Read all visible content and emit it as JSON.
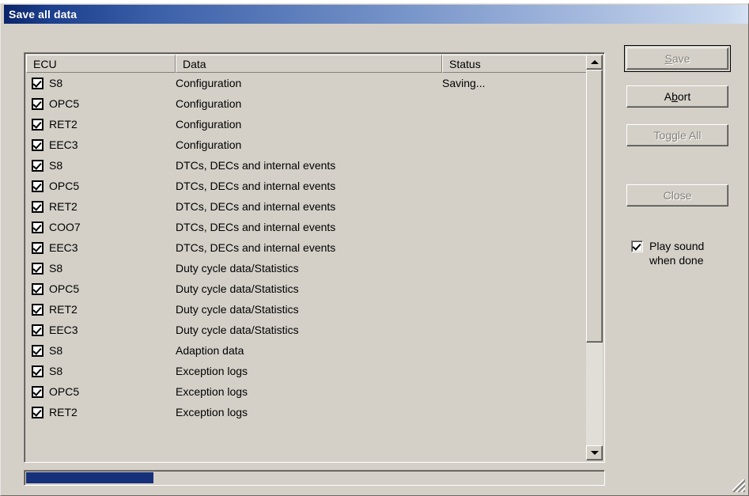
{
  "window": {
    "title": "Save all data"
  },
  "list": {
    "columns": [
      {
        "key": "ecu",
        "label": "ECU"
      },
      {
        "key": "data",
        "label": "Data"
      },
      {
        "key": "status",
        "label": "Status"
      }
    ],
    "rows": [
      {
        "checked": true,
        "ecu": "S8",
        "data": "Configuration",
        "status": "Saving..."
      },
      {
        "checked": true,
        "ecu": "OPC5",
        "data": "Configuration",
        "status": ""
      },
      {
        "checked": true,
        "ecu": "RET2",
        "data": "Configuration",
        "status": ""
      },
      {
        "checked": true,
        "ecu": "EEC3",
        "data": "Configuration",
        "status": ""
      },
      {
        "checked": true,
        "ecu": "S8",
        "data": "DTCs, DECs and internal events",
        "status": ""
      },
      {
        "checked": true,
        "ecu": "OPC5",
        "data": "DTCs, DECs and internal events",
        "status": ""
      },
      {
        "checked": true,
        "ecu": "RET2",
        "data": "DTCs, DECs and internal events",
        "status": ""
      },
      {
        "checked": true,
        "ecu": "COO7",
        "data": "DTCs, DECs and internal events",
        "status": ""
      },
      {
        "checked": true,
        "ecu": "EEC3",
        "data": "DTCs, DECs and internal events",
        "status": ""
      },
      {
        "checked": true,
        "ecu": "S8",
        "data": "Duty cycle data/Statistics",
        "status": ""
      },
      {
        "checked": true,
        "ecu": "OPC5",
        "data": "Duty cycle data/Statistics",
        "status": ""
      },
      {
        "checked": true,
        "ecu": "RET2",
        "data": "Duty cycle data/Statistics",
        "status": ""
      },
      {
        "checked": true,
        "ecu": "EEC3",
        "data": "Duty cycle data/Statistics",
        "status": ""
      },
      {
        "checked": true,
        "ecu": "S8",
        "data": "Adaption data",
        "status": ""
      },
      {
        "checked": true,
        "ecu": "S8",
        "data": "Exception logs",
        "status": ""
      },
      {
        "checked": true,
        "ecu": "OPC5",
        "data": "Exception logs",
        "status": ""
      },
      {
        "checked": true,
        "ecu": "RET2",
        "data": "Exception logs",
        "status": ""
      }
    ]
  },
  "scrollbar": {
    "up_arrow": "scroll-up-arrow",
    "down_arrow": "scroll-down-arrow"
  },
  "buttons": {
    "save": {
      "label": "Save",
      "accel": "S",
      "enabled": false,
      "default": true
    },
    "abort": {
      "label": "Abort",
      "accel": "b",
      "enabled": true,
      "default": false
    },
    "toggle_all": {
      "label": "Toggle All",
      "accel": "",
      "enabled": false,
      "default": false
    },
    "close": {
      "label": "Close",
      "accel": "",
      "enabled": false,
      "default": false
    }
  },
  "play_sound": {
    "line1": "Play sound",
    "line2": "when done",
    "checked": true
  },
  "progress": {
    "percent": 22
  },
  "colors": {
    "face": "#d4d0c8",
    "title_start": "#0a246a",
    "title_end": "#d6e2f4",
    "progress_fill": "#16307a",
    "disabled_text": "#83817c"
  }
}
